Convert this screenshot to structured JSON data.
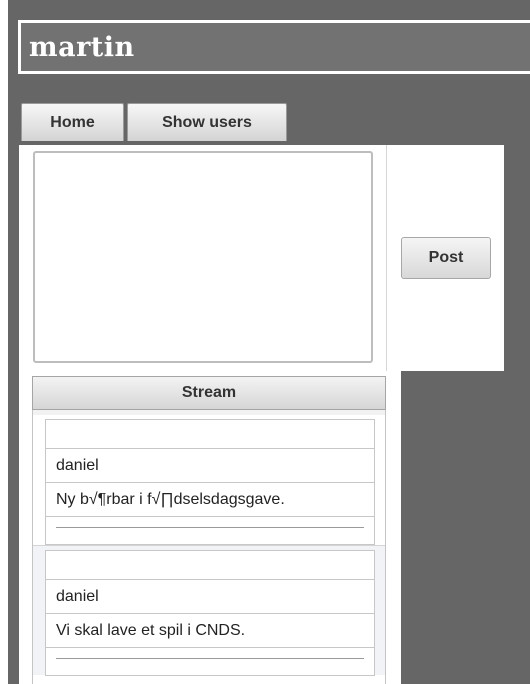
{
  "header": {
    "title": "martin"
  },
  "nav": {
    "tabs": [
      {
        "label": "Home"
      },
      {
        "label": "Show users"
      }
    ]
  },
  "composer": {
    "textarea_value": "",
    "post_label": "Post"
  },
  "stream": {
    "title": "Stream",
    "items": [
      {
        "user": "daniel",
        "text": "Ny b√¶rbar i f√∏dselsdagsgave."
      },
      {
        "user": "daniel",
        "text": "Vi skal lave et spil i CNDS."
      }
    ]
  },
  "colors": {
    "page_background": "#666666",
    "panel_background": "#ffffff",
    "alt_row_background": "#f1f3f7"
  }
}
